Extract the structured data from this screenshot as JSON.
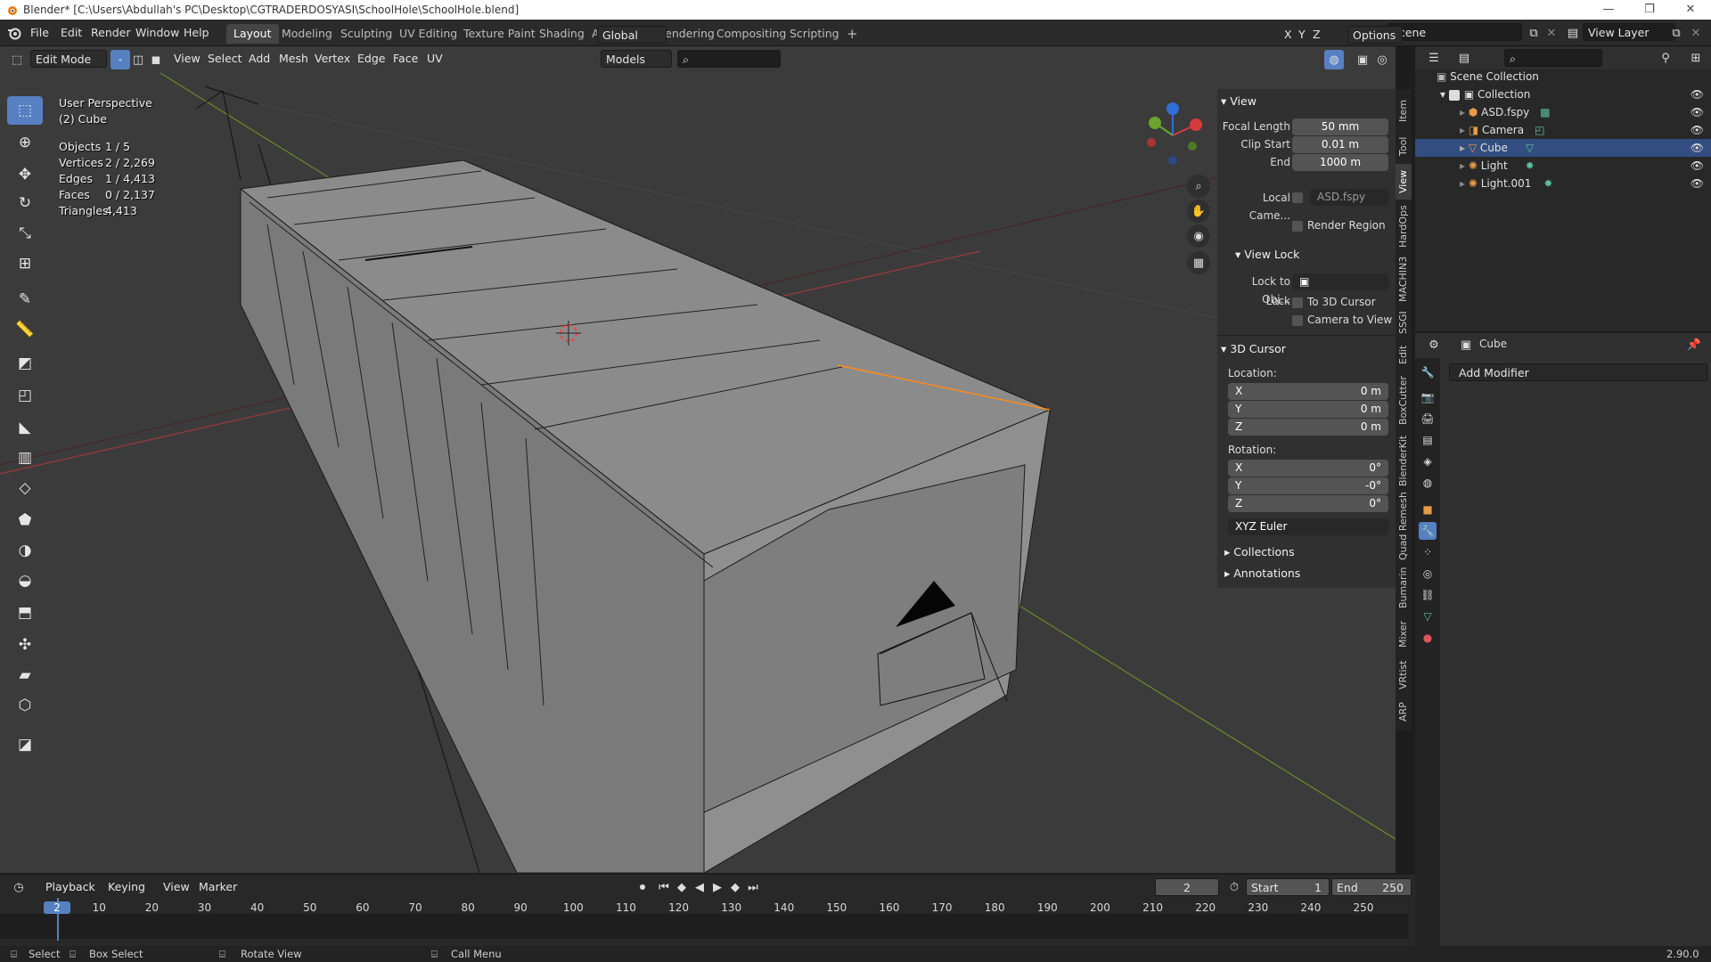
{
  "window": {
    "title": "Blender* [C:\\Users\\Abdullah's PC\\Desktop\\CGTRADERDOSYASI\\SchoolHole\\SchoolHole.blend]",
    "controls": [
      "—",
      "❐",
      "✕"
    ]
  },
  "menu": [
    "File",
    "Edit",
    "Render",
    "Window",
    "Help"
  ],
  "workspaces": [
    {
      "label": "Layout",
      "active": true
    },
    {
      "label": "Modeling"
    },
    {
      "label": "Sculpting"
    },
    {
      "label": "UV Editing"
    },
    {
      "label": "Texture Paint"
    },
    {
      "label": "Shading"
    },
    {
      "label": "Animation"
    },
    {
      "label": "Rendering"
    },
    {
      "label": "Compositing"
    },
    {
      "label": "Scripting"
    }
  ],
  "scene": {
    "label": "Scene",
    "view_layer": "View Layer"
  },
  "viewport_header": {
    "mode": "Edit Mode",
    "menus": [
      "View",
      "Select",
      "Add",
      "Mesh",
      "Vertex",
      "Edge",
      "Face",
      "UV"
    ],
    "transform_orientation": "Global",
    "collection_filter": "Models",
    "options": "Options",
    "axes": [
      "X",
      "Y",
      "Z"
    ]
  },
  "overlay": {
    "perspective": "User Perspective",
    "object": "(2) Cube",
    "stats": [
      {
        "label": "Objects",
        "value": "1 / 5"
      },
      {
        "label": "Vertices",
        "value": "2 / 2,269"
      },
      {
        "label": "Edges",
        "value": "1 / 4,413"
      },
      {
        "label": "Faces",
        "value": "0 / 2,137"
      },
      {
        "label": "Triangles",
        "value": "4,413"
      }
    ]
  },
  "npanel": {
    "view_title": "View",
    "focal_length_label": "Focal Length",
    "focal_length": "50 mm",
    "clip_start_label": "Clip Start",
    "clip_start": "0.01 m",
    "end_label": "End",
    "end": "1000 m",
    "local_camera_label": "Local Came...",
    "local_camera_value": "ASD.fspy",
    "render_region": "Render Region",
    "view_lock_title": "View Lock",
    "lock_to_obj_label": "Lock to Obj...",
    "lock_label": "Lock",
    "to_3d_cursor": "To 3D Cursor",
    "camera_to_view": "Camera to View",
    "cursor_title": "3D Cursor",
    "location_label": "Location:",
    "loc": [
      {
        "axis": "X",
        "value": "0 m"
      },
      {
        "axis": "Y",
        "value": "0 m"
      },
      {
        "axis": "Z",
        "value": "0 m"
      }
    ],
    "rotation_label": "Rotation:",
    "rot": [
      {
        "axis": "X",
        "value": "0°"
      },
      {
        "axis": "Y",
        "value": "-0°"
      },
      {
        "axis": "Z",
        "value": "0°"
      }
    ],
    "rotation_mode": "XYZ Euler",
    "collections": "Collections",
    "annotations": "Annotations"
  },
  "sidebar_tabs": [
    "Item",
    "Tool",
    "View",
    "HardOps",
    "MACHIN3",
    "SSGI",
    "Edit",
    "BoxCutter",
    "BlenderKit",
    "Quad Remesh",
    "Bumarin",
    "Mixer",
    "VRtist",
    "ARP"
  ],
  "outliner": {
    "root": "Scene Collection",
    "collection": "Collection",
    "items": [
      {
        "name": "ASD.fspy",
        "icon": "empty-icon",
        "selected": false
      },
      {
        "name": "Camera",
        "icon": "camera-icon",
        "selected": false
      },
      {
        "name": "Cube",
        "icon": "mesh-icon",
        "selected": true
      },
      {
        "name": "Light",
        "icon": "light-icon",
        "selected": false
      },
      {
        "name": "Light.001",
        "icon": "light-icon",
        "selected": false
      }
    ]
  },
  "properties": {
    "object_name": "Cube",
    "add_modifier": "Add Modifier"
  },
  "timeline": {
    "menus": [
      "Playback",
      "Keying",
      "View",
      "Marker"
    ],
    "current_frame": "2",
    "start_label": "Start",
    "start": "1",
    "end_label": "End",
    "end": "250",
    "ticks": [
      "2",
      "10",
      "20",
      "30",
      "40",
      "50",
      "60",
      "70",
      "80",
      "90",
      "100",
      "110",
      "120",
      "130",
      "140",
      "150",
      "160",
      "170",
      "180",
      "190",
      "200",
      "210",
      "220",
      "230",
      "240",
      "250"
    ]
  },
  "statusbar": {
    "select": "Select",
    "box_select": "Box Select",
    "rotate_view": "Rotate View",
    "call_menu": "Call Menu",
    "version": "2.90.0"
  },
  "colors": {
    "accent": "#5680c2",
    "selection": "#334d80",
    "viewport_bg": "#3b3b3b",
    "edge_selected": "#ff8a1c"
  }
}
